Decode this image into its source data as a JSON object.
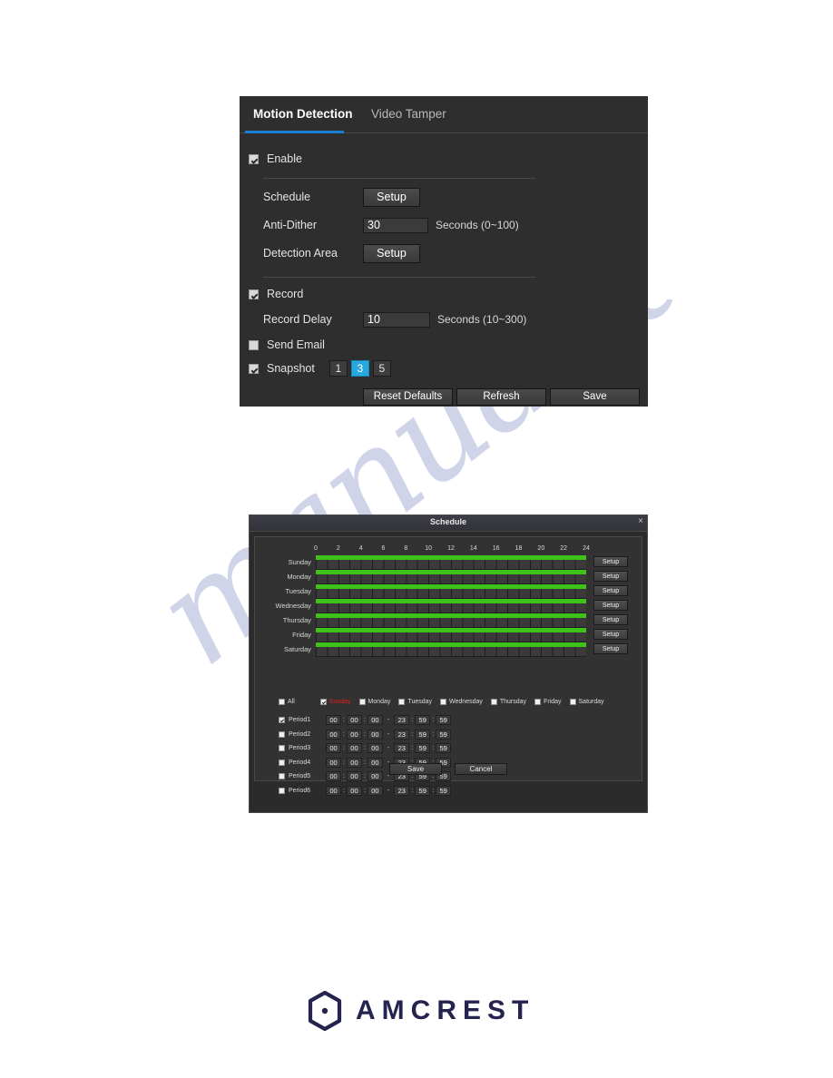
{
  "motion_detection": {
    "tabs": [
      {
        "label": "Motion Detection",
        "active": true
      },
      {
        "label": "Video Tamper",
        "active": false
      }
    ],
    "enable": {
      "label": "Enable",
      "checked": true
    },
    "fields": [
      {
        "label": "Schedule",
        "control": "button",
        "value": "Setup"
      },
      {
        "label": "Anti-Dither",
        "control": "text",
        "value": "30",
        "unit": "Seconds (0~100)"
      },
      {
        "label": "Detection Area",
        "control": "button",
        "value": "Setup"
      }
    ],
    "record": {
      "label": "Record",
      "checked": true
    },
    "record_delay": {
      "label": "Record Delay",
      "value": "10",
      "unit": "Seconds (10~300)"
    },
    "send_email": {
      "label": "Send Email",
      "checked": false
    },
    "snapshot": {
      "label": "Snapshot",
      "checked": true,
      "options": [
        "1",
        "3",
        "5"
      ],
      "selected": "3"
    },
    "actions": [
      {
        "label": "Reset Defaults"
      },
      {
        "label": "Refresh"
      },
      {
        "label": "Save"
      }
    ],
    "accent_color": "#29a8e0",
    "tab_underline_color": "#1a7fd4"
  },
  "schedule_dialog": {
    "title": "Schedule",
    "close_icon": "×",
    "axis_ticks": [
      "0",
      "2",
      "4",
      "6",
      "8",
      "10",
      "12",
      "14",
      "16",
      "18",
      "20",
      "22",
      "24"
    ],
    "rows": [
      {
        "day": "Sunday",
        "setup": "Setup",
        "bar_start": 0,
        "bar_end": 24
      },
      {
        "day": "Monday",
        "setup": "Setup",
        "bar_start": 0,
        "bar_end": 24
      },
      {
        "day": "Tuesday",
        "setup": "Setup",
        "bar_start": 0,
        "bar_end": 24
      },
      {
        "day": "Wednesday",
        "setup": "Setup",
        "bar_start": 0,
        "bar_end": 24
      },
      {
        "day": "Thursday",
        "setup": "Setup",
        "bar_start": 0,
        "bar_end": 24
      },
      {
        "day": "Friday",
        "setup": "Setup",
        "bar_start": 0,
        "bar_end": 24
      },
      {
        "day": "Saturday",
        "setup": "Setup",
        "bar_start": 0,
        "bar_end": 24
      }
    ],
    "day_filters": [
      {
        "label": "All",
        "checked": false,
        "highlight": false
      },
      {
        "label": "Sunday",
        "checked": true,
        "highlight": true
      },
      {
        "label": "Monday",
        "checked": false,
        "highlight": false
      },
      {
        "label": "Tuesday",
        "checked": false,
        "highlight": false
      },
      {
        "label": "Wednesday",
        "checked": false,
        "highlight": false
      },
      {
        "label": "Thursday",
        "checked": false,
        "highlight": false
      },
      {
        "label": "Friday",
        "checked": false,
        "highlight": false
      },
      {
        "label": "Saturday",
        "checked": false,
        "highlight": false
      }
    ],
    "periods": [
      {
        "name": "Period1",
        "checked": true,
        "start": [
          "00",
          "00",
          "00"
        ],
        "end": [
          "23",
          "59",
          "59"
        ]
      },
      {
        "name": "Period2",
        "checked": false,
        "start": [
          "00",
          "00",
          "00"
        ],
        "end": [
          "23",
          "59",
          "59"
        ]
      },
      {
        "name": "Period3",
        "checked": false,
        "start": [
          "00",
          "00",
          "00"
        ],
        "end": [
          "23",
          "59",
          "59"
        ]
      },
      {
        "name": "Period4",
        "checked": false,
        "start": [
          "00",
          "00",
          "00"
        ],
        "end": [
          "23",
          "59",
          "59"
        ]
      },
      {
        "name": "Period5",
        "checked": false,
        "start": [
          "00",
          "00",
          "00"
        ],
        "end": [
          "23",
          "59",
          "59"
        ]
      },
      {
        "name": "Period6",
        "checked": false,
        "start": [
          "00",
          "00",
          "00"
        ],
        "end": [
          "23",
          "59",
          "59"
        ]
      }
    ],
    "time_separator": ":",
    "range_separator": "-",
    "actions": [
      {
        "label": "Save"
      },
      {
        "label": "Cancel"
      }
    ],
    "bar_color": "#3fc11c",
    "selected_day_color": "#e02020"
  },
  "watermark": {
    "text": "manualsarchive.com",
    "color": "#2b3fa0"
  },
  "footer": {
    "brand": "AMCREST",
    "brand_color": "#24244e"
  }
}
